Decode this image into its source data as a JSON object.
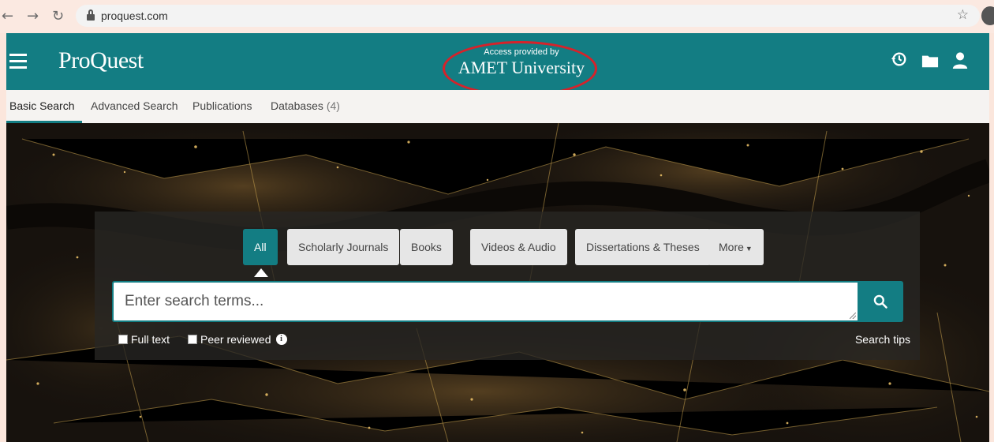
{
  "browser": {
    "url": "proquest.com"
  },
  "header": {
    "logo": "ProQuest",
    "access_small": "Access provided by",
    "access_institution": "AMET University"
  },
  "nav_tabs": [
    {
      "label": "Basic Search"
    },
    {
      "label": "Advanced Search"
    },
    {
      "label": "Publications"
    },
    {
      "label": "Databases",
      "count": "(4)"
    }
  ],
  "source_chips": [
    {
      "label": "All"
    },
    {
      "label": "Scholarly Journals"
    },
    {
      "label": "Books"
    },
    {
      "label": "Videos & Audio"
    },
    {
      "label": "Dissertations & Theses"
    },
    {
      "label": "More"
    }
  ],
  "search": {
    "placeholder": "Enter search terms...",
    "fulltext_label": "Full text",
    "peer_label": "Peer reviewed",
    "tips_label": "Search tips"
  },
  "colors": {
    "brand": "#137d83",
    "highlight_oval": "#d6222a"
  }
}
